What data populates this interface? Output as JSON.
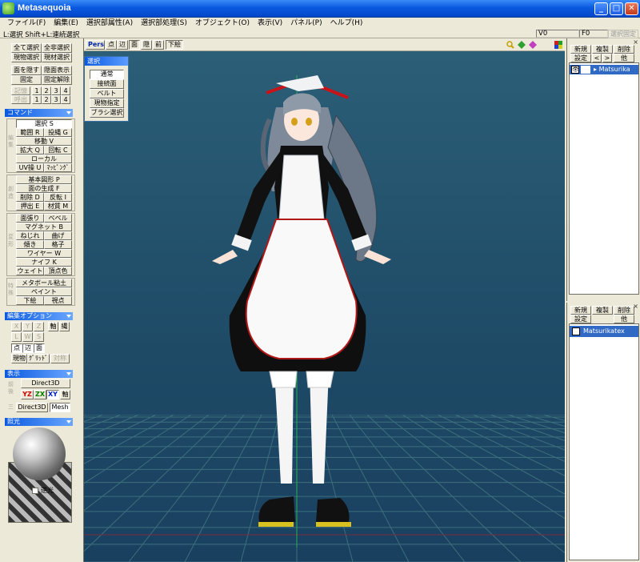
{
  "window": {
    "title": "Metasequoia",
    "minimize_glyph": "_",
    "maximize_glyph": "□",
    "close_glyph": "✕"
  },
  "menu": [
    "ファイル(F)",
    "編集(E)",
    "選択部属性(A)",
    "選択部処理(S)",
    "オブジェクト(O)",
    "表示(V)",
    "パネル(P)",
    "ヘルプ(H)"
  ],
  "status": {
    "hint": "L:選択 Shift+L:連続選択",
    "v_count": "V0",
    "f_count": "F0",
    "fixed_selection": "選択固定"
  },
  "left_panel": {
    "select_all": "全て選択",
    "select_inverse": "全非選択",
    "select_current": "現物選択",
    "select_material": "現材選択",
    "hide_faces": "面を隠す",
    "show_hidden": "隠面表示",
    "fix": "固定",
    "unfix": "固定解除",
    "memory_label": "記憶",
    "recall_label": "呼出",
    "slots": [
      "1",
      "2",
      "3",
      "4"
    ],
    "command_header": "コマンド",
    "edit_group_label": "編集",
    "cmd_select": "選択 S",
    "cmd_range": "範囲 R",
    "cmd_lasso": "投縄 G",
    "cmd_move": "移動 V",
    "cmd_scale": "拡大 Q",
    "cmd_rotate": "回転 C",
    "cmd_local": "ローカル",
    "cmd_uv": "UV操 U",
    "cmd_mapping": "ﾏｯﾋﾟﾝｸﾞ",
    "create_group_label": "創造",
    "cmd_primitive": "基本図形 P",
    "cmd_face_gen": "面の生成 F",
    "cmd_delete": "削除 D",
    "cmd_flip": "反転 I",
    "cmd_extrude": "押出 E",
    "cmd_material": "材質 M",
    "deform_group_label": "変形",
    "cmd_face_extend": "面張り",
    "cmd_bevel": "ベベル",
    "cmd_magnet": "マグネット B",
    "cmd_twist": "ねじれ",
    "cmd_bend": "曲げ",
    "cmd_tilt": "傾き",
    "cmd_lattice": "格子",
    "cmd_wire": "ワイヤー W",
    "cmd_knife": "ナイフ K",
    "cmd_weight": "ウェイト",
    "cmd_vertex_color": "頂点色",
    "special_group_label": "特殊",
    "cmd_metaball": "メタボール粘土",
    "cmd_paint": "ペイント",
    "cmd_underlay": "下絵",
    "cmd_viewpoint": "視点",
    "edit_option_header": "編集オプション",
    "opt_x": "X",
    "opt_y": "Y",
    "opt_z": "Z",
    "opt_axis": "軸",
    "opt_lasso": "縄",
    "opt_l": "L",
    "opt_w": "W",
    "opt_s": "S",
    "opt_point": "点",
    "opt_edge": "辺",
    "opt_face": "面",
    "opt_current_obj": "現物",
    "opt_grid": "ｸﾞﾘｯﾄﾞ",
    "opt_symmetry": "対称",
    "display_header": "表示",
    "disp_label": "前後",
    "disp_direct3d": "Direct3D",
    "disp_yz": "YZ",
    "disp_zx": "ZX",
    "disp_xy": "XY",
    "disp_axis": "軸",
    "disp_direct3d_small": "Direct3D",
    "disp_mesh": "Mesh",
    "disp_all_label": "三",
    "light_header": "照光",
    "light_backlight": "逆光"
  },
  "viewport": {
    "mode": "Pers",
    "view_buttons": [
      "点",
      "辺",
      "面",
      "隠",
      "前"
    ],
    "underlay": "下絵"
  },
  "selection_palette": {
    "title": "選択",
    "items": [
      "通常",
      "接続面",
      "ベルト",
      "現物指定",
      "ブラシ選択"
    ]
  },
  "object_panel": {
    "new": "新規",
    "duplicate": "複製",
    "delete": "削除",
    "settings": "設定",
    "prev": "<",
    "next": ">",
    "other": "他",
    "objects": [
      "Matsurika"
    ]
  },
  "material_panel": {
    "new": "新規",
    "duplicate": "複製",
    "delete": "削除",
    "settings": "設定",
    "other": "他",
    "materials": [
      "Matsurikatex"
    ]
  },
  "colors": {
    "titlebar": "#0a5ae0",
    "viewport_bg": "#234f69",
    "selection": "#316ac5",
    "grid": "#3d6f7c"
  }
}
